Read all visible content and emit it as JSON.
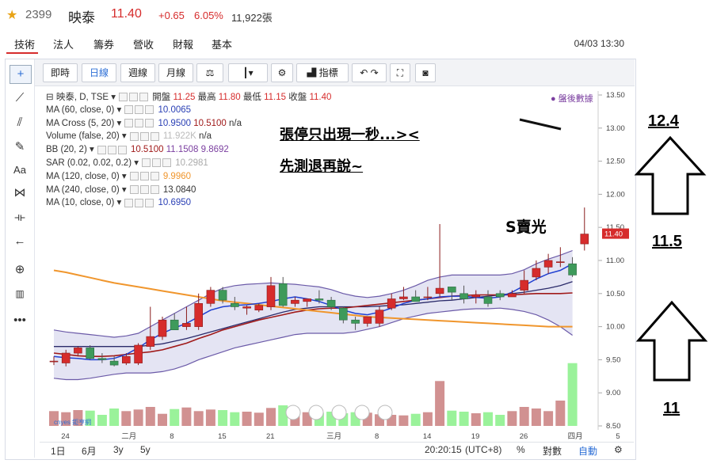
{
  "header": {
    "code": "2399",
    "name": "映泰",
    "price": "11.40",
    "change": "+0.65",
    "change_pct": "6.05%",
    "volume": "11,922張"
  },
  "main_tabs": [
    {
      "label": "技術"
    },
    {
      "label": "法人"
    },
    {
      "label": "籌券"
    },
    {
      "label": "營收"
    },
    {
      "label": "財報"
    },
    {
      "label": "基本"
    }
  ],
  "datetime": "04/03 13:30",
  "toolbar": {
    "intraday": "即時",
    "daily": "日線",
    "weekly": "週線",
    "monthly": "月線",
    "indicators": "指標"
  },
  "indicators": [
    {
      "label": "映泰, D, TSE",
      "values": [
        {
          "t": "開盤 ",
          "c": "#333"
        },
        {
          "t": "11.25",
          "c": "#d62c2c"
        },
        {
          "t": " 最高 ",
          "c": "#333"
        },
        {
          "t": "11.80",
          "c": "#d62c2c"
        },
        {
          "t": " 最低 ",
          "c": "#333"
        },
        {
          "t": "11.15",
          "c": "#d62c2c"
        },
        {
          "t": " 收盤 ",
          "c": "#333"
        },
        {
          "t": "11.40",
          "c": "#d62c2c"
        }
      ]
    },
    {
      "label": "MA (60, close, 0)",
      "values": [
        {
          "t": "10.0065",
          "c": "#2b40b5"
        }
      ]
    },
    {
      "label": "MA Cross (5, 20)",
      "values": [
        {
          "t": "10.9500",
          "c": "#2b40b5"
        },
        {
          "t": " 10.5100",
          "c": "#a01a1a"
        },
        {
          "t": " n/a",
          "c": "#333"
        }
      ]
    },
    {
      "label": "Volume (false, 20)",
      "values": [
        {
          "t": "11.922K",
          "c": "#bbbbbb"
        },
        {
          "t": " n/a",
          "c": "#333"
        }
      ]
    },
    {
      "label": "BB (20, 2)",
      "values": [
        {
          "t": "10.5100",
          "c": "#a01a1a"
        },
        {
          "t": " 11.1508",
          "c": "#7b3fa0"
        },
        {
          "t": " 9.8692",
          "c": "#7b3fa0"
        }
      ]
    },
    {
      "label": "SAR (0.02, 0.02, 0.2)",
      "values": [
        {
          "t": "10.2981",
          "c": "#aaaaaa"
        }
      ]
    },
    {
      "label": "MA (120, close, 0)",
      "values": [
        {
          "t": "9.9960",
          "c": "#f0962d"
        }
      ]
    },
    {
      "label": "MA (240, close, 0)",
      "values": [
        {
          "t": "13.0840",
          "c": "#333"
        }
      ]
    },
    {
      "label": "MA (10, close, 0)",
      "values": [
        {
          "t": "10.6950",
          "c": "#2b40b5"
        }
      ]
    }
  ],
  "after_hours": "● 盤後數據",
  "annotations": {
    "line1": "張停只出現一秒...><",
    "line2": "先測退再說~",
    "sell": "S賣光",
    "target_high": "12.4",
    "target_mid": "11.5",
    "target_low": "11",
    "price_tag": "11.40"
  },
  "bottom": {
    "ranges": [
      "1日",
      "6月",
      "3y",
      "5y"
    ],
    "clock": "20:20:15",
    "tz": "(UTC+8)",
    "pct": "%",
    "log": "對數",
    "auto": "自動"
  },
  "watermark": "cnyes 鉅亨網",
  "colors": {
    "up": "#d62c2c",
    "down": "#3e9a5b",
    "vol_up": "#c97e7e",
    "vol_down": "#88f088",
    "ma_orange": "#f0962d",
    "bb_fill": "#c9c9e8",
    "bb_line": "#6b5aa8",
    "ma_dark": "#a01a1a",
    "ma_blue": "#1f3fd1"
  },
  "chart_data": {
    "type": "candlestick",
    "ylim": [
      8.5,
      13.5
    ],
    "y_ticks": [
      "13.50",
      "13.00",
      "12.50",
      "12.00",
      "11.50",
      "11.00",
      "10.50",
      "10.00",
      "9.50",
      "9.00",
      "8.50"
    ],
    "x_tick_labels": [
      "24",
      "二月",
      "8",
      "15",
      "21",
      "三月",
      "8",
      "14",
      "19",
      "26",
      "四月",
      "5"
    ],
    "x_tick_index": [
      1,
      6,
      10,
      14,
      18,
      23,
      27,
      31,
      35,
      39,
      43,
      47
    ],
    "candles": [
      {
        "o": 9.47,
        "h": 9.55,
        "l": 9.42,
        "c": 9.48
      },
      {
        "o": 9.45,
        "h": 9.65,
        "l": 9.4,
        "c": 9.6
      },
      {
        "o": 9.6,
        "h": 9.7,
        "l": 9.55,
        "c": 9.68
      },
      {
        "o": 9.68,
        "h": 9.72,
        "l": 9.5,
        "c": 9.52
      },
      {
        "o": 9.52,
        "h": 9.6,
        "l": 9.45,
        "c": 9.5
      },
      {
        "o": 9.48,
        "h": 9.55,
        "l": 9.4,
        "c": 9.42
      },
      {
        "o": 9.45,
        "h": 9.6,
        "l": 9.42,
        "c": 9.55
      },
      {
        "o": 9.45,
        "h": 9.75,
        "l": 9.42,
        "c": 9.72
      },
      {
        "o": 9.7,
        "h": 10.3,
        "l": 9.65,
        "c": 9.85
      },
      {
        "o": 9.85,
        "h": 10.15,
        "l": 9.8,
        "c": 10.1
      },
      {
        "o": 10.1,
        "h": 10.2,
        "l": 9.95,
        "c": 9.95
      },
      {
        "o": 10.0,
        "h": 10.3,
        "l": 9.95,
        "c": 10.05
      },
      {
        "o": 10.0,
        "h": 10.5,
        "l": 9.95,
        "c": 10.35
      },
      {
        "o": 10.35,
        "h": 10.6,
        "l": 10.3,
        "c": 10.55
      },
      {
        "o": 10.55,
        "h": 10.6,
        "l": 10.35,
        "c": 10.4
      },
      {
        "o": 10.35,
        "h": 10.45,
        "l": 10.25,
        "c": 10.3
      },
      {
        "o": 10.28,
        "h": 10.32,
        "l": 10.18,
        "c": 10.3
      },
      {
        "o": 10.25,
        "h": 10.35,
        "l": 10.22,
        "c": 10.32
      },
      {
        "o": 10.3,
        "h": 10.75,
        "l": 10.25,
        "c": 10.62
      },
      {
        "o": 10.65,
        "h": 10.75,
        "l": 10.3,
        "c": 10.32
      },
      {
        "o": 10.35,
        "h": 10.45,
        "l": 10.3,
        "c": 10.4
      },
      {
        "o": 10.38,
        "h": 10.42,
        "l": 10.3,
        "c": 10.42
      },
      {
        "o": 10.42,
        "h": 10.55,
        "l": 10.35,
        "c": 10.4
      },
      {
        "o": 10.4,
        "h": 10.45,
        "l": 10.25,
        "c": 10.3
      },
      {
        "o": 10.28,
        "h": 10.3,
        "l": 10.05,
        "c": 10.1
      },
      {
        "o": 10.1,
        "h": 10.15,
        "l": 9.95,
        "c": 10.05
      },
      {
        "o": 10.05,
        "h": 10.15,
        "l": 10.0,
        "c": 10.15
      },
      {
        "o": 10.05,
        "h": 10.3,
        "l": 10.0,
        "c": 10.25
      },
      {
        "o": 10.28,
        "h": 10.5,
        "l": 10.25,
        "c": 10.42
      },
      {
        "o": 10.42,
        "h": 10.6,
        "l": 10.4,
        "c": 10.45
      },
      {
        "o": 10.45,
        "h": 10.55,
        "l": 10.4,
        "c": 10.38
      },
      {
        "o": 10.45,
        "h": 10.6,
        "l": 10.4,
        "c": 10.45
      },
      {
        "o": 10.5,
        "h": 11.55,
        "l": 10.45,
        "c": 10.58
      },
      {
        "o": 10.6,
        "h": 10.6,
        "l": 10.4,
        "c": 10.52
      },
      {
        "o": 10.5,
        "h": 10.62,
        "l": 10.35,
        "c": 10.42
      },
      {
        "o": 10.45,
        "h": 10.55,
        "l": 10.35,
        "c": 10.48
      },
      {
        "o": 10.45,
        "h": 10.55,
        "l": 10.3,
        "c": 10.35
      },
      {
        "o": 10.5,
        "h": 10.55,
        "l": 10.4,
        "c": 10.45
      },
      {
        "o": 10.45,
        "h": 10.55,
        "l": 10.45,
        "c": 10.5
      },
      {
        "o": 10.55,
        "h": 10.85,
        "l": 10.5,
        "c": 10.7
      },
      {
        "o": 10.75,
        "h": 11.0,
        "l": 10.7,
        "c": 10.88
      },
      {
        "o": 10.9,
        "h": 11.1,
        "l": 10.8,
        "c": 11.0
      },
      {
        "o": 10.98,
        "h": 11.2,
        "l": 10.9,
        "c": 10.98
      },
      {
        "o": 10.95,
        "h": 11.05,
        "l": 10.75,
        "c": 10.78
      },
      {
        "o": 11.25,
        "h": 11.8,
        "l": 11.15,
        "c": 11.4
      }
    ],
    "volume_max": 12000,
    "volume": [
      2800,
      2600,
      3000,
      2900,
      2100,
      3300,
      2800,
      3100,
      3600,
      2300,
      3200,
      3500,
      2800,
      3100,
      3000,
      2600,
      2700,
      2500,
      3400,
      3900,
      2800,
      2600,
      2500,
      2700,
      2400,
      2600,
      2500,
      2200,
      2100,
      2000,
      2300,
      2600,
      8500,
      2900,
      2700,
      2400,
      2600,
      2100,
      2800,
      3600,
      3300,
      2800,
      4800,
      11900
    ],
    "ma_orange": [
      10.85,
      10.82,
      10.78,
      10.74,
      10.7,
      10.66,
      10.63,
      10.6,
      10.57,
      10.54,
      10.51,
      10.48,
      10.45,
      10.42,
      10.39,
      10.37,
      10.35,
      10.33,
      10.31,
      10.29,
      10.27,
      10.25,
      10.23,
      10.21,
      10.19,
      10.17,
      10.15,
      10.14,
      10.13,
      10.12,
      10.11,
      10.1,
      10.09,
      10.08,
      10.07,
      10.06,
      10.05,
      10.04,
      10.03,
      10.02,
      10.01,
      10.0,
      10.0,
      10.0
    ],
    "bb_upper": [
      9.95,
      9.92,
      9.9,
      9.88,
      9.86,
      9.84,
      9.86,
      9.9,
      10.0,
      10.1,
      10.2,
      10.3,
      10.4,
      10.5,
      10.58,
      10.62,
      10.64,
      10.65,
      10.66,
      10.65,
      10.64,
      10.62,
      10.6,
      10.56,
      10.5,
      10.46,
      10.44,
      10.46,
      10.5,
      10.55,
      10.62,
      10.7,
      10.75,
      10.78,
      10.78,
      10.78,
      10.78,
      10.78,
      10.8,
      10.86,
      10.95,
      11.02,
      11.08,
      11.15
    ],
    "bb_lower": [
      9.22,
      9.2,
      9.2,
      9.22,
      9.25,
      9.28,
      9.3,
      9.3,
      9.3,
      9.32,
      9.36,
      9.42,
      9.5,
      9.56,
      9.62,
      9.68,
      9.72,
      9.76,
      9.8,
      9.84,
      9.88,
      9.9,
      9.9,
      9.9,
      9.9,
      9.92,
      9.96,
      10.0,
      10.06,
      10.12,
      10.16,
      10.2,
      10.22,
      10.24,
      10.26,
      10.27,
      10.27,
      10.28,
      10.26,
      10.23,
      10.18,
      10.1,
      10.0,
      9.87
    ],
    "bb_mid": [
      9.6,
      9.58,
      9.56,
      9.55,
      9.55,
      9.56,
      9.58,
      9.6,
      9.62,
      9.65,
      9.7,
      9.75,
      9.82,
      9.88,
      9.95,
      10.0,
      10.05,
      10.1,
      10.14,
      10.18,
      10.22,
      10.25,
      10.27,
      10.28,
      10.28,
      10.3,
      10.32,
      10.34,
      10.36,
      10.38,
      10.4,
      10.42,
      10.44,
      10.46,
      10.47,
      10.48,
      10.48,
      10.48,
      10.48,
      10.49,
      10.5,
      10.5,
      10.5,
      10.51
    ],
    "ma_blue": [
      9.55,
      9.53,
      9.52,
      9.5,
      9.5,
      9.52,
      9.58,
      9.68,
      9.8,
      9.9,
      9.98,
      10.05,
      10.15,
      10.25,
      10.3,
      10.32,
      10.33,
      10.35,
      10.38,
      10.42,
      10.45,
      10.42,
      10.38,
      10.32,
      10.25,
      10.2,
      10.18,
      10.22,
      10.28,
      10.35,
      10.4,
      10.42,
      10.45,
      10.46,
      10.46,
      10.44,
      10.43,
      10.45,
      10.52,
      10.62,
      10.72,
      10.8,
      10.85,
      10.95
    ],
    "ma_navy": [
      9.7,
      9.7,
      9.7,
      9.7,
      9.7,
      9.7,
      9.7,
      9.7,
      9.72,
      9.74,
      9.78,
      9.82,
      9.87,
      9.92,
      9.97,
      10.02,
      10.07,
      10.12,
      10.17,
      10.22,
      10.26,
      10.28,
      10.3,
      10.3,
      10.3,
      10.3,
      10.3,
      10.31,
      10.32,
      10.33,
      10.35,
      10.37,
      10.39,
      10.4,
      10.42,
      10.44,
      10.46,
      10.48,
      10.5,
      10.52,
      10.55,
      10.58,
      10.62,
      10.68
    ]
  }
}
